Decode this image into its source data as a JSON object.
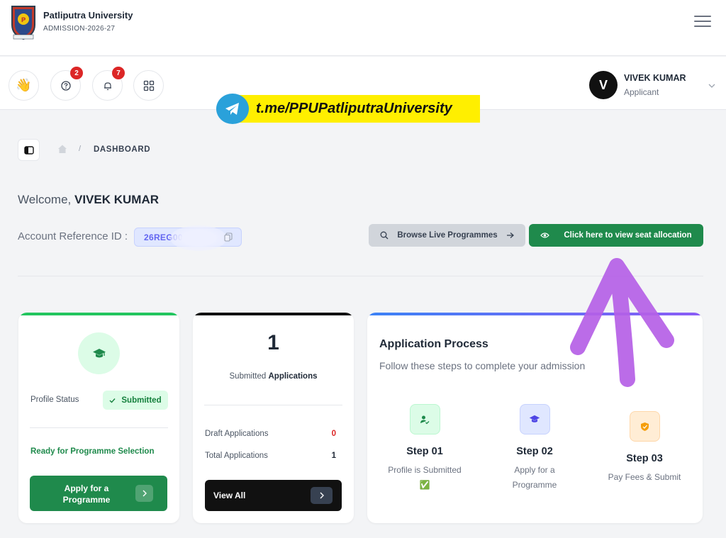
{
  "header": {
    "brand_name": "Patliputra University",
    "brand_sub": "ADMISSION-2026-27"
  },
  "toolbar": {
    "help_badge": "2",
    "notifications_badge": "7"
  },
  "user": {
    "initial": "V",
    "name": "VIVEK KUMAR",
    "role": "Applicant"
  },
  "overlay": {
    "telegram_text": "t.me/PPUPatliputraUniversity"
  },
  "breadcrumb": {
    "current": "DASHBOARD"
  },
  "welcome": {
    "greeting": "Welcome, ",
    "name": "VIVEK KUMAR",
    "account_label": "Account Reference ID :",
    "account_value": "26REG00"
  },
  "actions": {
    "browse_label": "Browse Live Programmes",
    "seat_label": "Click here to view seat allocation"
  },
  "profile_card": {
    "status_label": "Profile Status",
    "status_value": "Submitted",
    "ready_text": "Ready for Programme Selection",
    "apply_label": "Apply for a Programme"
  },
  "applications_card": {
    "count": "1",
    "subtitle_plain": "Submitted ",
    "subtitle_bold": "Applications",
    "draft_label": "Draft Applications",
    "draft_value": "0",
    "total_label": "Total Applications",
    "total_value": "1",
    "view_all_label": "View All"
  },
  "process_card": {
    "title": "Application Process",
    "subtitle": "Follow these steps to complete your admission",
    "steps": [
      {
        "title": "Step 01",
        "desc": "Profile is Submitted",
        "extra": "✅"
      },
      {
        "title": "Step 02",
        "desc": "Apply for a Programme"
      },
      {
        "title": "Step 03",
        "desc": "Pay Fees & Submit"
      }
    ]
  },
  "colors": {
    "primary_green": "#1f8a4c",
    "badge_red": "#dc2626",
    "accent_indigo": "#6366f1",
    "annotation_purple": "#b560e6",
    "telegram_blue": "#2aa1da",
    "banner_yellow": "#ffef00"
  }
}
